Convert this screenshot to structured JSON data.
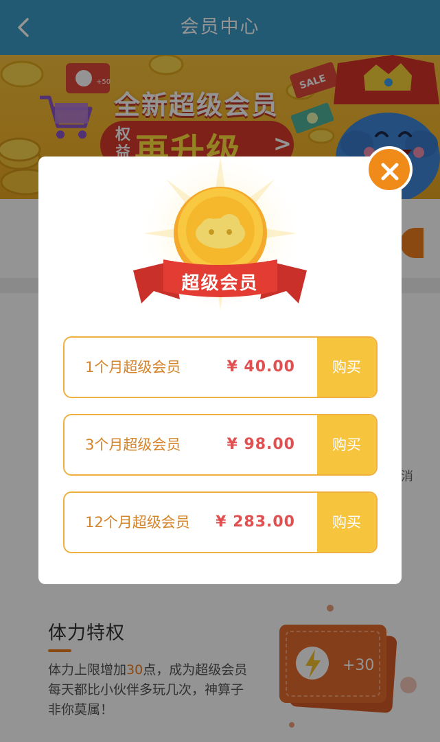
{
  "header": {
    "title": "会员中心",
    "back_icon": "chevron-left-icon",
    "bg_color": "#3a9cc4"
  },
  "banner": {
    "title": "全新超级会员",
    "pill_side": "权益",
    "pill_main": "再升级",
    "pill_arrow": ">",
    "sale_tag": "SALE",
    "coupon_label": "+50"
  },
  "page": {
    "side_text": "消",
    "feature": {
      "title": "体力特权",
      "desc_pre": "体力上限增加",
      "desc_highlight": "30",
      "desc_post": "点，成为超级会员每天都比小伙伴多玩几次，神算子非你莫属！",
      "ticket_label": "+30",
      "ticket_icon": "lightning-icon"
    }
  },
  "modal": {
    "ribbon_text": "超级会员",
    "coin_icon": "cloud-coin-icon",
    "close_icon": "close-icon",
    "accent_color": "#f7c53d",
    "options": [
      {
        "name": "1个月超级会员",
        "price": "¥ 40.00",
        "buy": "购买"
      },
      {
        "name": "3个月超级会员",
        "price": "¥ 98.00",
        "buy": "购买"
      },
      {
        "name": "12个月超级会员",
        "price": "¥ 283.00",
        "buy": "购买"
      }
    ]
  }
}
